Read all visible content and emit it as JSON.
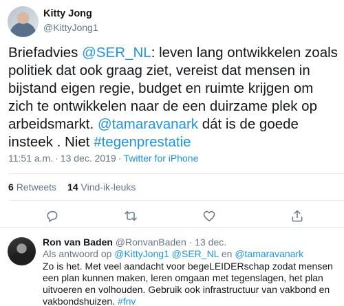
{
  "tweet": {
    "author_name": "Kitty Jong",
    "author_handle": "@KittyJong1",
    "text_parts": {
      "p1": "Briefadvies ",
      "mention_ser": "@SER_NL",
      "p2": ": leven lang ontwikkelen zoals politiek dat ook graag ziet, vereist dat mensen in bijstand eigen regie, budget en ruimte krijgen om zich te ontwikkelen naar de een duirzame plek op arbeidsmarkt. ",
      "mention_tamara": "@tamaravanark",
      "p3": " dát is de goede insteek . Niet ",
      "hashtag": "#tegenprestatie"
    },
    "time": "11:51 a.m.",
    "separator": "·",
    "date": "13 dec. 2019",
    "source": "Twitter for iPhone",
    "retweets_count": "6",
    "retweets_label": "Retweets",
    "likes_count": "14",
    "likes_label": "Vind-ik-leuks"
  },
  "actions": {
    "reply_icon": "reply-icon",
    "retweet_icon": "retweet-icon",
    "like_icon": "heart-icon",
    "share_icon": "share-icon"
  },
  "reply": {
    "author_name": "Ron van Baden",
    "author_handle": "@RonvanBaden",
    "separator": "·",
    "date": "13 dec.",
    "reply_to_prefix": "Als antwoord op ",
    "reply_to_1": "@KittyJong1",
    "reply_to_2": "@SER_NL",
    "reply_to_and": " en ",
    "reply_to_3": "@tamaravanark",
    "text": "Zo is het. Met veel aandacht voor begeLEIDERschap zodat mensen een plan kunnen maken, leren omgaan met tegenslagen, het plan uitvoeren en volhouden. Gebruik ook infrastructuur van vakbond en vakbondshuizen. ",
    "hashtag": "#fnv"
  },
  "colors": {
    "link": "#1b95e0",
    "text": "#14171a",
    "muted": "#657786",
    "divider": "#e6ecf0"
  }
}
